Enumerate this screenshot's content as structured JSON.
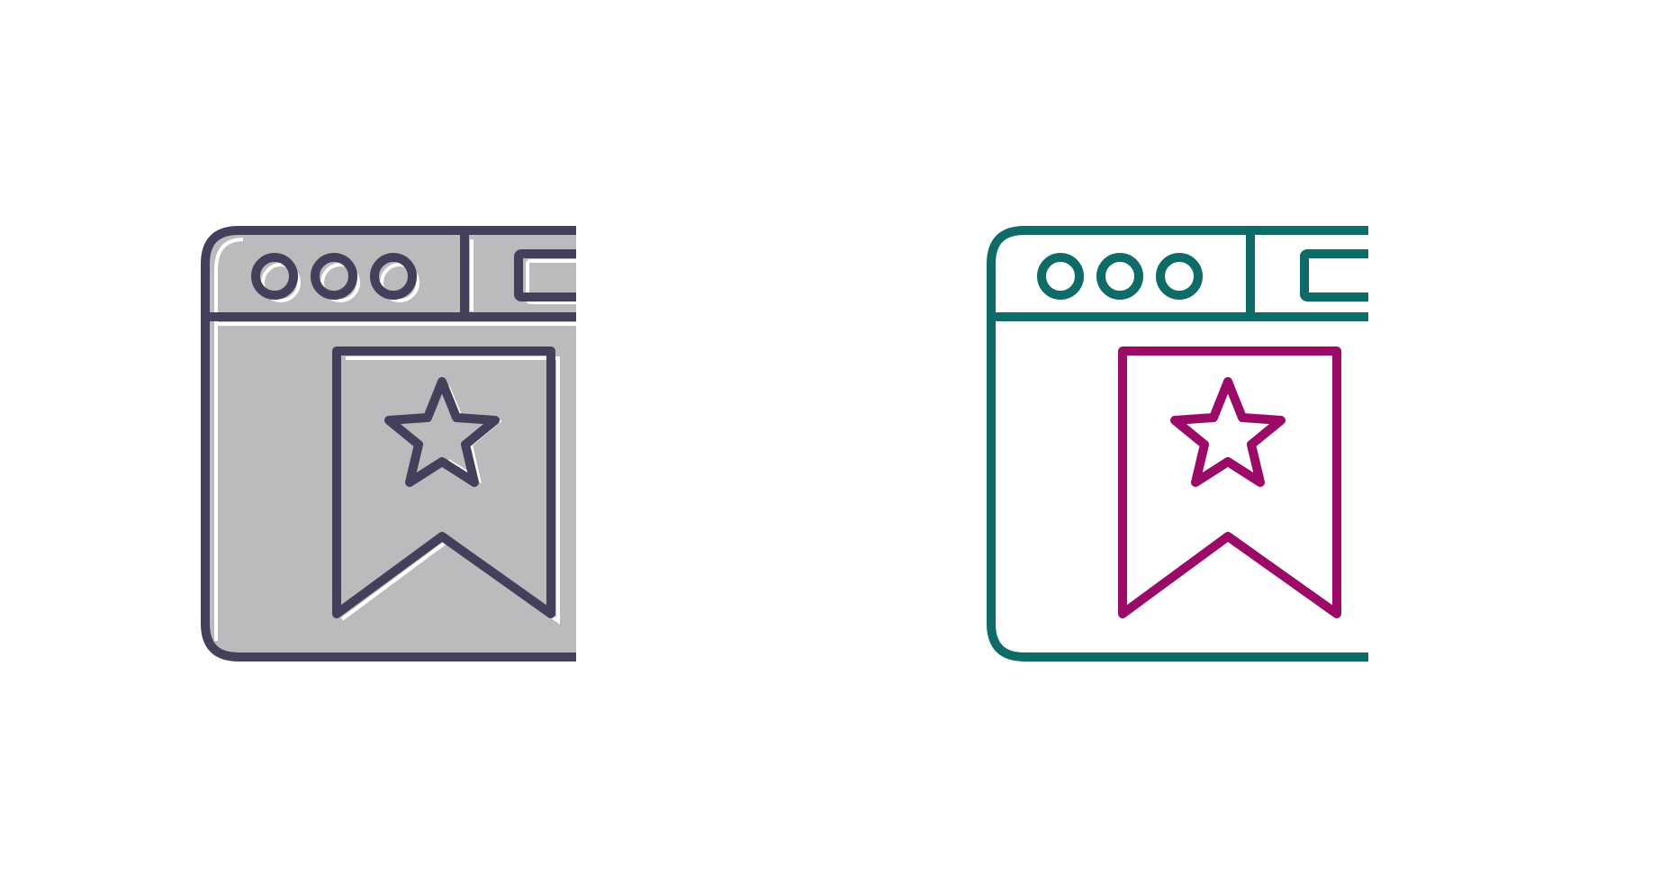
{
  "icons": [
    {
      "name": "bookmark-webpage-icon-filled",
      "style": "glyph-with-fill",
      "stroke_color": "#453f5c",
      "fill_color": "#bbbbbd",
      "accent_color": "#453f5c",
      "highlight_color": "#ffffff",
      "elements": [
        "browser-window",
        "window-control-circles",
        "address-bar",
        "bookmark-ribbon",
        "star"
      ]
    },
    {
      "name": "bookmark-webpage-icon-outline",
      "style": "two-tone-outline",
      "stroke_color": "#0e6b67",
      "fill_color": "#ffffff",
      "accent_color": "#9a0a66",
      "elements": [
        "browser-window",
        "window-control-circles",
        "address-bar",
        "bookmark-ribbon",
        "star"
      ]
    }
  ]
}
